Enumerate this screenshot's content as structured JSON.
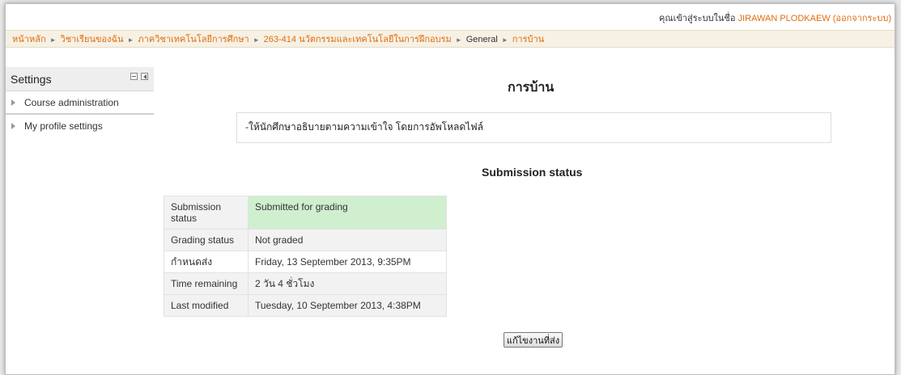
{
  "header": {
    "login_prefix": "คุณเข้าสู่ระบบในชื่อ",
    "user_name": "JIRAWAN PLODKAEW",
    "logout_link": "(ออกจากระบบ)"
  },
  "breadcrumb": {
    "items": [
      "หน้าหลัก",
      "วิชาเรียนของฉัน",
      "ภาควิชาเทคโนโลยีการศึกษา",
      "263-414 นวัตกรรมและเทคโนโลยีในการฝึกอบรม",
      "General",
      "การบ้าน"
    ],
    "separator": "►"
  },
  "settings_block": {
    "title": "Settings",
    "items": [
      {
        "label": "Course administration",
        "icon": "triangle-right-icon"
      },
      {
        "label": "My profile settings",
        "icon": "triangle-right-icon"
      }
    ]
  },
  "main": {
    "title": "การบ้าน",
    "intro": "-ให้นักศึกษาอธิบายตามความเข้าใจ โดยการอัพโหลดไฟล์",
    "submission_heading": "Submission status",
    "status_table": [
      {
        "label": "Submission status",
        "value": "Submitted for grading"
      },
      {
        "label": "Grading status",
        "value": "Not graded"
      },
      {
        "label": "กำหนดส่ง",
        "value": "Friday, 13 September 2013, 9:35PM"
      },
      {
        "label": "Time remaining",
        "value": "2 วัน 4 ชั่วโมง"
      },
      {
        "label": "Last modified",
        "value": "Tuesday, 10 September 2013, 4:38PM"
      }
    ],
    "edit_button": "แก้ไขงานที่ส่ง"
  },
  "colors": {
    "link": "#e06c0e",
    "breadcrumb_bg": "#f6f1e4",
    "submitted_cell": "#cfefcf"
  }
}
